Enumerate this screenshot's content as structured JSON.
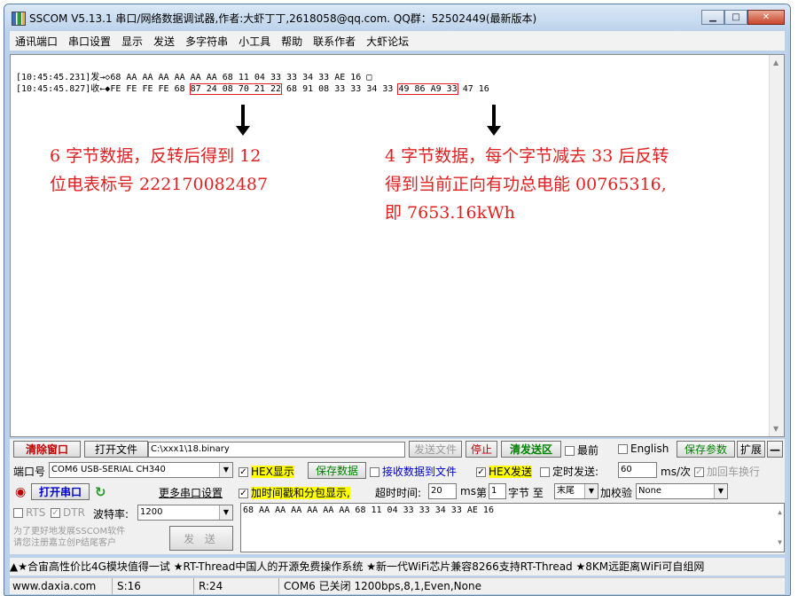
{
  "window": {
    "title": "SSCOM V5.13.1 串口/网络数据调试器,作者:大虾丁丁,2618058@qq.com. QQ群：52502449(最新版本)"
  },
  "menu": [
    "通讯端口",
    "串口设置",
    "显示",
    "发送",
    "多字符串",
    "小工具",
    "帮助",
    "联系作者",
    "大虾论坛"
  ],
  "receive": {
    "line1": "[10:45:45.231]发→◇68 AA AA AA AA AA AA 68 11 04 33 33 34 33 AE 16 □",
    "line2_prefix": "[10:45:45.827]收←◆FE FE FE FE 68 ",
    "line2_meter": "87 24 08 70 21 22",
    "line2_mid": " 68 91 08 33 33 34 33 ",
    "line2_energy": "49 86 A9 33",
    "line2_suffix": " 47 16"
  },
  "annotations": {
    "left": [
      "6 字节数据，反转后得到 12",
      "位电表标号 222170082487"
    ],
    "right": [
      "4 字节数据，每个字节减去 33 后反转",
      "得到当前正向有功总电能 00765316,",
      "即 7653.16kWh"
    ]
  },
  "toolbar": {
    "clear_label": "清除窗口",
    "open_file_label": "打开文件",
    "file_path": "C:\\xxx1\\18.binary",
    "send_file_label": "发送文件",
    "stop_label": "停止",
    "clear_send_label": "清发送区",
    "front_label": "最前",
    "english_label": "English",
    "save_params_label": "保存参数",
    "expand_label": "扩展",
    "collapse_label": "—"
  },
  "controls": {
    "port_label": "端口号",
    "port_value": "COM6 USB-SERIAL CH340",
    "hex_show_label": "HEX显示",
    "save_data_label": "保存数据",
    "recv_to_file_label": "接收数据到文件",
    "hex_send_label": "HEX发送",
    "timed_send_label": "定时发送:",
    "timed_value": "60",
    "timed_unit": "ms/次",
    "add_newline_label": "加回车换行",
    "open_port_label": "打开串口",
    "more_settings_label": "更多串口设置",
    "timestamp_label": "加时间戳和分包显示,",
    "timeout_label": "超时时间:",
    "timeout_value": "20",
    "timeout_unit": "ms",
    "frame_label": "第",
    "frame_value": "1",
    "byte_label": "字节 至",
    "end_value": "末尾",
    "checksum_label": "加校验",
    "checksum_value": "None",
    "rts_label": "RTS",
    "dtr_label": "DTR",
    "baud_label": "波特率:",
    "baud_value": "1200",
    "send_text": "68 AA AA AA AA AA AA 68 11 04 33 33 34 33 AE 16",
    "promo_line1": "为了更好地发展SSCOM软件",
    "promo_line2": "请您注册嘉立创P结尾客户",
    "send_label": "发 送"
  },
  "ticker": "▲★合宙高性价比4G模块值得一试 ★RT-Thread中国人的开源免费操作系统 ★新一代WiFi芯片兼容8266支持RT-Thread ★8KM远距离WiFi可自组网",
  "status": {
    "website": "www.daxia.com",
    "sent": "S:16",
    "received": "R:24",
    "port_state": "COM6 已关闭  1200bps,8,1,Even,None"
  }
}
